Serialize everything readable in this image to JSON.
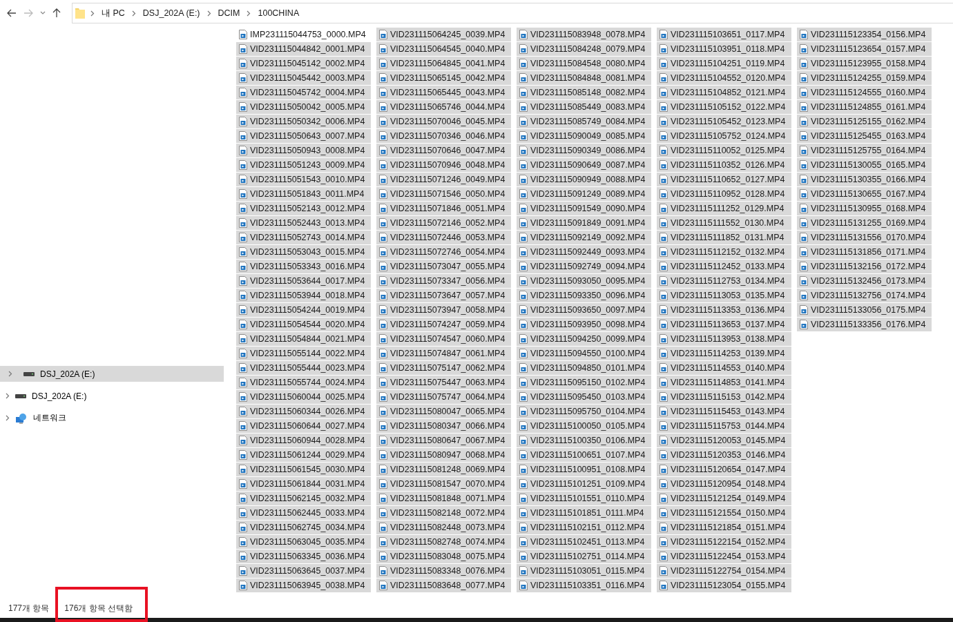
{
  "address_bar": {
    "path": [
      "내 PC",
      "DSJ_202A (E:)",
      "DCIM",
      "100CHINA"
    ]
  },
  "sidebar": {
    "items": [
      {
        "label": "DSJ_202A (E:)",
        "kind": "drive",
        "selected": true,
        "expanded": false
      },
      {
        "label": "DSJ_202A (E:)",
        "kind": "drive",
        "selected": false,
        "expanded": false
      },
      {
        "label": "네트워크",
        "kind": "network",
        "selected": false,
        "expanded": false
      }
    ]
  },
  "files": [
    {
      "name": "IMP231115044753_0000.MP4",
      "selected": false
    },
    {
      "name": "VID231115044842_0001.MP4",
      "selected": true
    },
    {
      "name": "VID231115045142_0002.MP4",
      "selected": true
    },
    {
      "name": "VID231115045442_0003.MP4",
      "selected": true
    },
    {
      "name": "VID231115045742_0004.MP4",
      "selected": true
    },
    {
      "name": "VID231115050042_0005.MP4",
      "selected": true
    },
    {
      "name": "VID231115050342_0006.MP4",
      "selected": true
    },
    {
      "name": "VID231115050643_0007.MP4",
      "selected": true
    },
    {
      "name": "VID231115050943_0008.MP4",
      "selected": true
    },
    {
      "name": "VID231115051243_0009.MP4",
      "selected": true
    },
    {
      "name": "VID231115051543_0010.MP4",
      "selected": true
    },
    {
      "name": "VID231115051843_0011.MP4",
      "selected": true
    },
    {
      "name": "VID231115052143_0012.MP4",
      "selected": true
    },
    {
      "name": "VID231115052443_0013.MP4",
      "selected": true
    },
    {
      "name": "VID231115052743_0014.MP4",
      "selected": true
    },
    {
      "name": "VID231115053043_0015.MP4",
      "selected": true
    },
    {
      "name": "VID231115053343_0016.MP4",
      "selected": true
    },
    {
      "name": "VID231115053644_0017.MP4",
      "selected": true
    },
    {
      "name": "VID231115053944_0018.MP4",
      "selected": true
    },
    {
      "name": "VID231115054244_0019.MP4",
      "selected": true
    },
    {
      "name": "VID231115054544_0020.MP4",
      "selected": true
    },
    {
      "name": "VID231115054844_0021.MP4",
      "selected": true
    },
    {
      "name": "VID231115055144_0022.MP4",
      "selected": true
    },
    {
      "name": "VID231115055444_0023.MP4",
      "selected": true
    },
    {
      "name": "VID231115055744_0024.MP4",
      "selected": true
    },
    {
      "name": "VID231115060044_0025.MP4",
      "selected": true
    },
    {
      "name": "VID231115060344_0026.MP4",
      "selected": true
    },
    {
      "name": "VID231115060644_0027.MP4",
      "selected": true
    },
    {
      "name": "VID231115060944_0028.MP4",
      "selected": true
    },
    {
      "name": "VID231115061244_0029.MP4",
      "selected": true
    },
    {
      "name": "VID231115061545_0030.MP4",
      "selected": true
    },
    {
      "name": "VID231115061844_0031.MP4",
      "selected": true
    },
    {
      "name": "VID231115062145_0032.MP4",
      "selected": true
    },
    {
      "name": "VID231115062445_0033.MP4",
      "selected": true
    },
    {
      "name": "VID231115062745_0034.MP4",
      "selected": true
    },
    {
      "name": "VID231115063045_0035.MP4",
      "selected": true
    },
    {
      "name": "VID231115063345_0036.MP4",
      "selected": true
    },
    {
      "name": "VID231115063645_0037.MP4",
      "selected": true
    },
    {
      "name": "VID231115063945_0038.MP4",
      "selected": true
    },
    {
      "name": "VID231115064245_0039.MP4",
      "selected": true
    },
    {
      "name": "VID231115064545_0040.MP4",
      "selected": true
    },
    {
      "name": "VID231115064845_0041.MP4",
      "selected": true
    },
    {
      "name": "VID231115065145_0042.MP4",
      "selected": true
    },
    {
      "name": "VID231115065445_0043.MP4",
      "selected": true
    },
    {
      "name": "VID231115065746_0044.MP4",
      "selected": true
    },
    {
      "name": "VID231115070046_0045.MP4",
      "selected": true
    },
    {
      "name": "VID231115070346_0046.MP4",
      "selected": true
    },
    {
      "name": "VID231115070646_0047.MP4",
      "selected": true
    },
    {
      "name": "VID231115070946_0048.MP4",
      "selected": true
    },
    {
      "name": "VID231115071246_0049.MP4",
      "selected": true
    },
    {
      "name": "VID231115071546_0050.MP4",
      "selected": true
    },
    {
      "name": "VID231115071846_0051.MP4",
      "selected": true
    },
    {
      "name": "VID231115072146_0052.MP4",
      "selected": true
    },
    {
      "name": "VID231115072446_0053.MP4",
      "selected": true
    },
    {
      "name": "VID231115072746_0054.MP4",
      "selected": true
    },
    {
      "name": "VID231115073047_0055.MP4",
      "selected": true
    },
    {
      "name": "VID231115073347_0056.MP4",
      "selected": true
    },
    {
      "name": "VID231115073647_0057.MP4",
      "selected": true
    },
    {
      "name": "VID231115073947_0058.MP4",
      "selected": true
    },
    {
      "name": "VID231115074247_0059.MP4",
      "selected": true
    },
    {
      "name": "VID231115074547_0060.MP4",
      "selected": true
    },
    {
      "name": "VID231115074847_0061.MP4",
      "selected": true
    },
    {
      "name": "VID231115075147_0062.MP4",
      "selected": true
    },
    {
      "name": "VID231115075447_0063.MP4",
      "selected": true
    },
    {
      "name": "VID231115075747_0064.MP4",
      "selected": true
    },
    {
      "name": "VID231115080047_0065.MP4",
      "selected": true
    },
    {
      "name": "VID231115080347_0066.MP4",
      "selected": true
    },
    {
      "name": "VID231115080647_0067.MP4",
      "selected": true
    },
    {
      "name": "VID231115080947_0068.MP4",
      "selected": true
    },
    {
      "name": "VID231115081248_0069.MP4",
      "selected": true
    },
    {
      "name": "VID231115081547_0070.MP4",
      "selected": true
    },
    {
      "name": "VID231115081848_0071.MP4",
      "selected": true
    },
    {
      "name": "VID231115082148_0072.MP4",
      "selected": true
    },
    {
      "name": "VID231115082448_0073.MP4",
      "selected": true
    },
    {
      "name": "VID231115082748_0074.MP4",
      "selected": true
    },
    {
      "name": "VID231115083048_0075.MP4",
      "selected": true
    },
    {
      "name": "VID231115083348_0076.MP4",
      "selected": true
    },
    {
      "name": "VID231115083648_0077.MP4",
      "selected": true
    },
    {
      "name": "VID231115083948_0078.MP4",
      "selected": true
    },
    {
      "name": "VID231115084248_0079.MP4",
      "selected": true
    },
    {
      "name": "VID231115084548_0080.MP4",
      "selected": true
    },
    {
      "name": "VID231115084848_0081.MP4",
      "selected": true
    },
    {
      "name": "VID231115085148_0082.MP4",
      "selected": true
    },
    {
      "name": "VID231115085449_0083.MP4",
      "selected": true
    },
    {
      "name": "VID231115085749_0084.MP4",
      "selected": true
    },
    {
      "name": "VID231115090049_0085.MP4",
      "selected": true
    },
    {
      "name": "VID231115090349_0086.MP4",
      "selected": true
    },
    {
      "name": "VID231115090649_0087.MP4",
      "selected": true
    },
    {
      "name": "VID231115090949_0088.MP4",
      "selected": true
    },
    {
      "name": "VID231115091249_0089.MP4",
      "selected": true
    },
    {
      "name": "VID231115091549_0090.MP4",
      "selected": true
    },
    {
      "name": "VID231115091849_0091.MP4",
      "selected": true
    },
    {
      "name": "VID231115092149_0092.MP4",
      "selected": true
    },
    {
      "name": "VID231115092449_0093.MP4",
      "selected": true
    },
    {
      "name": "VID231115092749_0094.MP4",
      "selected": true
    },
    {
      "name": "VID231115093050_0095.MP4",
      "selected": true
    },
    {
      "name": "VID231115093350_0096.MP4",
      "selected": true
    },
    {
      "name": "VID231115093650_0097.MP4",
      "selected": true
    },
    {
      "name": "VID231115093950_0098.MP4",
      "selected": true
    },
    {
      "name": "VID231115094250_0099.MP4",
      "selected": true
    },
    {
      "name": "VID231115094550_0100.MP4",
      "selected": true
    },
    {
      "name": "VID231115094850_0101.MP4",
      "selected": true
    },
    {
      "name": "VID231115095150_0102.MP4",
      "selected": true
    },
    {
      "name": "VID231115095450_0103.MP4",
      "selected": true
    },
    {
      "name": "VID231115095750_0104.MP4",
      "selected": true
    },
    {
      "name": "VID231115100050_0105.MP4",
      "selected": true
    },
    {
      "name": "VID231115100350_0106.MP4",
      "selected": true
    },
    {
      "name": "VID231115100651_0107.MP4",
      "selected": true
    },
    {
      "name": "VID231115100951_0108.MP4",
      "selected": true
    },
    {
      "name": "VID231115101251_0109.MP4",
      "selected": true
    },
    {
      "name": "VID231115101551_0110.MP4",
      "selected": true
    },
    {
      "name": "VID231115101851_0111.MP4",
      "selected": true
    },
    {
      "name": "VID231115102151_0112.MP4",
      "selected": true
    },
    {
      "name": "VID231115102451_0113.MP4",
      "selected": true
    },
    {
      "name": "VID231115102751_0114.MP4",
      "selected": true
    },
    {
      "name": "VID231115103051_0115.MP4",
      "selected": true
    },
    {
      "name": "VID231115103351_0116.MP4",
      "selected": true
    },
    {
      "name": "VID231115103651_0117.MP4",
      "selected": true
    },
    {
      "name": "VID231115103951_0118.MP4",
      "selected": true
    },
    {
      "name": "VID231115104251_0119.MP4",
      "selected": true
    },
    {
      "name": "VID231115104552_0120.MP4",
      "selected": true
    },
    {
      "name": "VID231115104852_0121.MP4",
      "selected": true
    },
    {
      "name": "VID231115105152_0122.MP4",
      "selected": true
    },
    {
      "name": "VID231115105452_0123.MP4",
      "selected": true
    },
    {
      "name": "VID231115105752_0124.MP4",
      "selected": true
    },
    {
      "name": "VID231115110052_0125.MP4",
      "selected": true
    },
    {
      "name": "VID231115110352_0126.MP4",
      "selected": true
    },
    {
      "name": "VID231115110652_0127.MP4",
      "selected": true
    },
    {
      "name": "VID231115110952_0128.MP4",
      "selected": true
    },
    {
      "name": "VID231115111252_0129.MP4",
      "selected": true
    },
    {
      "name": "VID231115111552_0130.MP4",
      "selected": true
    },
    {
      "name": "VID231115111852_0131.MP4",
      "selected": true
    },
    {
      "name": "VID231115112152_0132.MP4",
      "selected": true
    },
    {
      "name": "VID231115112452_0133.MP4",
      "selected": true
    },
    {
      "name": "VID231115112753_0134.MP4",
      "selected": true
    },
    {
      "name": "VID231115113053_0135.MP4",
      "selected": true
    },
    {
      "name": "VID231115113353_0136.MP4",
      "selected": true
    },
    {
      "name": "VID231115113653_0137.MP4",
      "selected": true
    },
    {
      "name": "VID231115113953_0138.MP4",
      "selected": true
    },
    {
      "name": "VID231115114253_0139.MP4",
      "selected": true
    },
    {
      "name": "VID231115114553_0140.MP4",
      "selected": true
    },
    {
      "name": "VID231115114853_0141.MP4",
      "selected": true
    },
    {
      "name": "VID231115115153_0142.MP4",
      "selected": true
    },
    {
      "name": "VID231115115453_0143.MP4",
      "selected": true
    },
    {
      "name": "VID231115115753_0144.MP4",
      "selected": true
    },
    {
      "name": "VID231115120053_0145.MP4",
      "selected": true
    },
    {
      "name": "VID231115120353_0146.MP4",
      "selected": true
    },
    {
      "name": "VID231115120654_0147.MP4",
      "selected": true
    },
    {
      "name": "VID231115120954_0148.MP4",
      "selected": true
    },
    {
      "name": "VID231115121254_0149.MP4",
      "selected": true
    },
    {
      "name": "VID231115121554_0150.MP4",
      "selected": true
    },
    {
      "name": "VID231115121854_0151.MP4",
      "selected": true
    },
    {
      "name": "VID231115122154_0152.MP4",
      "selected": true
    },
    {
      "name": "VID231115122454_0153.MP4",
      "selected": true
    },
    {
      "name": "VID231115122754_0154.MP4",
      "selected": true
    },
    {
      "name": "VID231115123054_0155.MP4",
      "selected": true
    },
    {
      "name": "VID231115123354_0156.MP4",
      "selected": true
    },
    {
      "name": "VID231115123654_0157.MP4",
      "selected": true
    },
    {
      "name": "VID231115123955_0158.MP4",
      "selected": true
    },
    {
      "name": "VID231115124255_0159.MP4",
      "selected": true
    },
    {
      "name": "VID231115124555_0160.MP4",
      "selected": true
    },
    {
      "name": "VID231115124855_0161.MP4",
      "selected": true
    },
    {
      "name": "VID231115125155_0162.MP4",
      "selected": true
    },
    {
      "name": "VID231115125455_0163.MP4",
      "selected": true
    },
    {
      "name": "VID231115125755_0164.MP4",
      "selected": true
    },
    {
      "name": "VID231115130055_0165.MP4",
      "selected": true
    },
    {
      "name": "VID231115130355_0166.MP4",
      "selected": true
    },
    {
      "name": "VID231115130655_0167.MP4",
      "selected": true
    },
    {
      "name": "VID231115130955_0168.MP4",
      "selected": true
    },
    {
      "name": "VID231115131255_0169.MP4",
      "selected": true
    },
    {
      "name": "VID231115131556_0170.MP4",
      "selected": true
    },
    {
      "name": "VID231115131856_0171.MP4",
      "selected": true
    },
    {
      "name": "VID231115132156_0172.MP4",
      "selected": true
    },
    {
      "name": "VID231115132456_0173.MP4",
      "selected": true
    },
    {
      "name": "VID231115132756_0174.MP4",
      "selected": true
    },
    {
      "name": "VID231115133056_0175.MP4",
      "selected": true
    },
    {
      "name": "VID231115133356_0176.MP4",
      "selected": true
    }
  ],
  "status_bar": {
    "item_count": "177개 항목",
    "selection": "176개 항목 선택함"
  }
}
